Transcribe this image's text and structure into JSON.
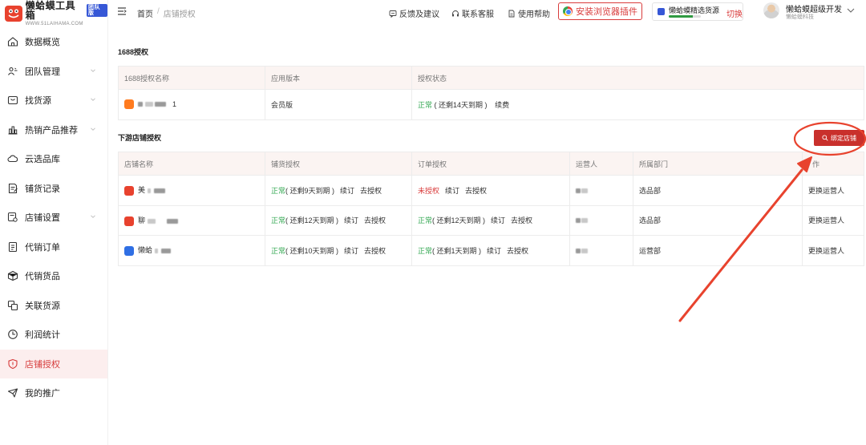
{
  "app": {
    "logo_title": "懒蛤蟆工具箱",
    "logo_badge": "团队版",
    "logo_url": "WWW.51LAIHAMA.COM"
  },
  "sidebar": {
    "items": [
      {
        "label": "数据概览",
        "icon": "home-icon",
        "expandable": false,
        "active": false
      },
      {
        "label": "团队管理",
        "icon": "team-icon",
        "expandable": true,
        "active": false
      },
      {
        "label": "找货源",
        "icon": "box-icon",
        "expandable": true,
        "active": false
      },
      {
        "label": "热销产品推荐",
        "icon": "chart-icon",
        "expandable": true,
        "active": false
      },
      {
        "label": "云选品库",
        "icon": "cloud-icon",
        "expandable": false,
        "active": false
      },
      {
        "label": "铺货记录",
        "icon": "record-icon",
        "expandable": false,
        "active": false
      },
      {
        "label": "店铺设置",
        "icon": "settings-icon",
        "expandable": true,
        "active": false
      },
      {
        "label": "代销订单",
        "icon": "order-icon",
        "expandable": false,
        "active": false
      },
      {
        "label": "代销货品",
        "icon": "goods-icon",
        "expandable": false,
        "active": false
      },
      {
        "label": "关联货源",
        "icon": "link-icon",
        "expandable": false,
        "active": false
      },
      {
        "label": "利润统计",
        "icon": "clock-icon",
        "expandable": false,
        "active": false
      },
      {
        "label": "店铺授权",
        "icon": "shield-icon",
        "expandable": false,
        "active": true
      },
      {
        "label": "我的推广",
        "icon": "promo-icon",
        "expandable": false,
        "active": false
      }
    ]
  },
  "header": {
    "breadcrumb": {
      "home": "首页",
      "sep": "/",
      "current": "店铺授权"
    },
    "links": {
      "feedback": "反馈及建议",
      "support": "联系客服",
      "help": "使用帮助"
    },
    "extension_button": "安装浏览器插件",
    "source": {
      "name": "懒蛤蟆精选货源",
      "switch": "切换",
      "progress": 0.75
    },
    "user": {
      "name": "懒蛤蟆超级开发",
      "org": "懒蛤蟆科技"
    }
  },
  "auth1688": {
    "title": "1688授权",
    "columns": [
      "1688授权名称",
      "应用版本",
      "授权状态"
    ],
    "row": {
      "name_suffix": "1",
      "version": "会员版",
      "status": "正常",
      "status_note": "( 还剩14天到期 )",
      "action": "续费"
    }
  },
  "shops": {
    "title": "下游店铺授权",
    "bind_button": "绑定店铺",
    "columns": [
      "店铺名称",
      "铺货授权",
      "订单授权",
      "运营人",
      "所属部门",
      "作"
    ],
    "rows": [
      {
        "name_prefix": "美",
        "listing_status": "正常",
        "listing_note": "( 还剩9天到期 )",
        "order_status": "未授权",
        "order_note": "",
        "dept": "选品部",
        "action": "更换运营人"
      },
      {
        "name_prefix": "聊",
        "listing_status": "正常",
        "listing_note": "( 还剩12天到期 )",
        "order_status": "正常",
        "order_note": "( 还剩12天到期 )",
        "dept": "选品部",
        "action": "更换运营人"
      },
      {
        "name_prefix": "懒蛤",
        "listing_status": "正常",
        "listing_note": "( 还剩10天到期 )",
        "order_status": "正常",
        "order_note": "( 还剩1天到期 )",
        "dept": "运营部",
        "action": "更换运营人"
      }
    ],
    "renew": "续订",
    "authorize": "去授权"
  },
  "colors": {
    "accent": "#d93c3c",
    "ok": "#34a853",
    "annotation": "#e8432e"
  }
}
